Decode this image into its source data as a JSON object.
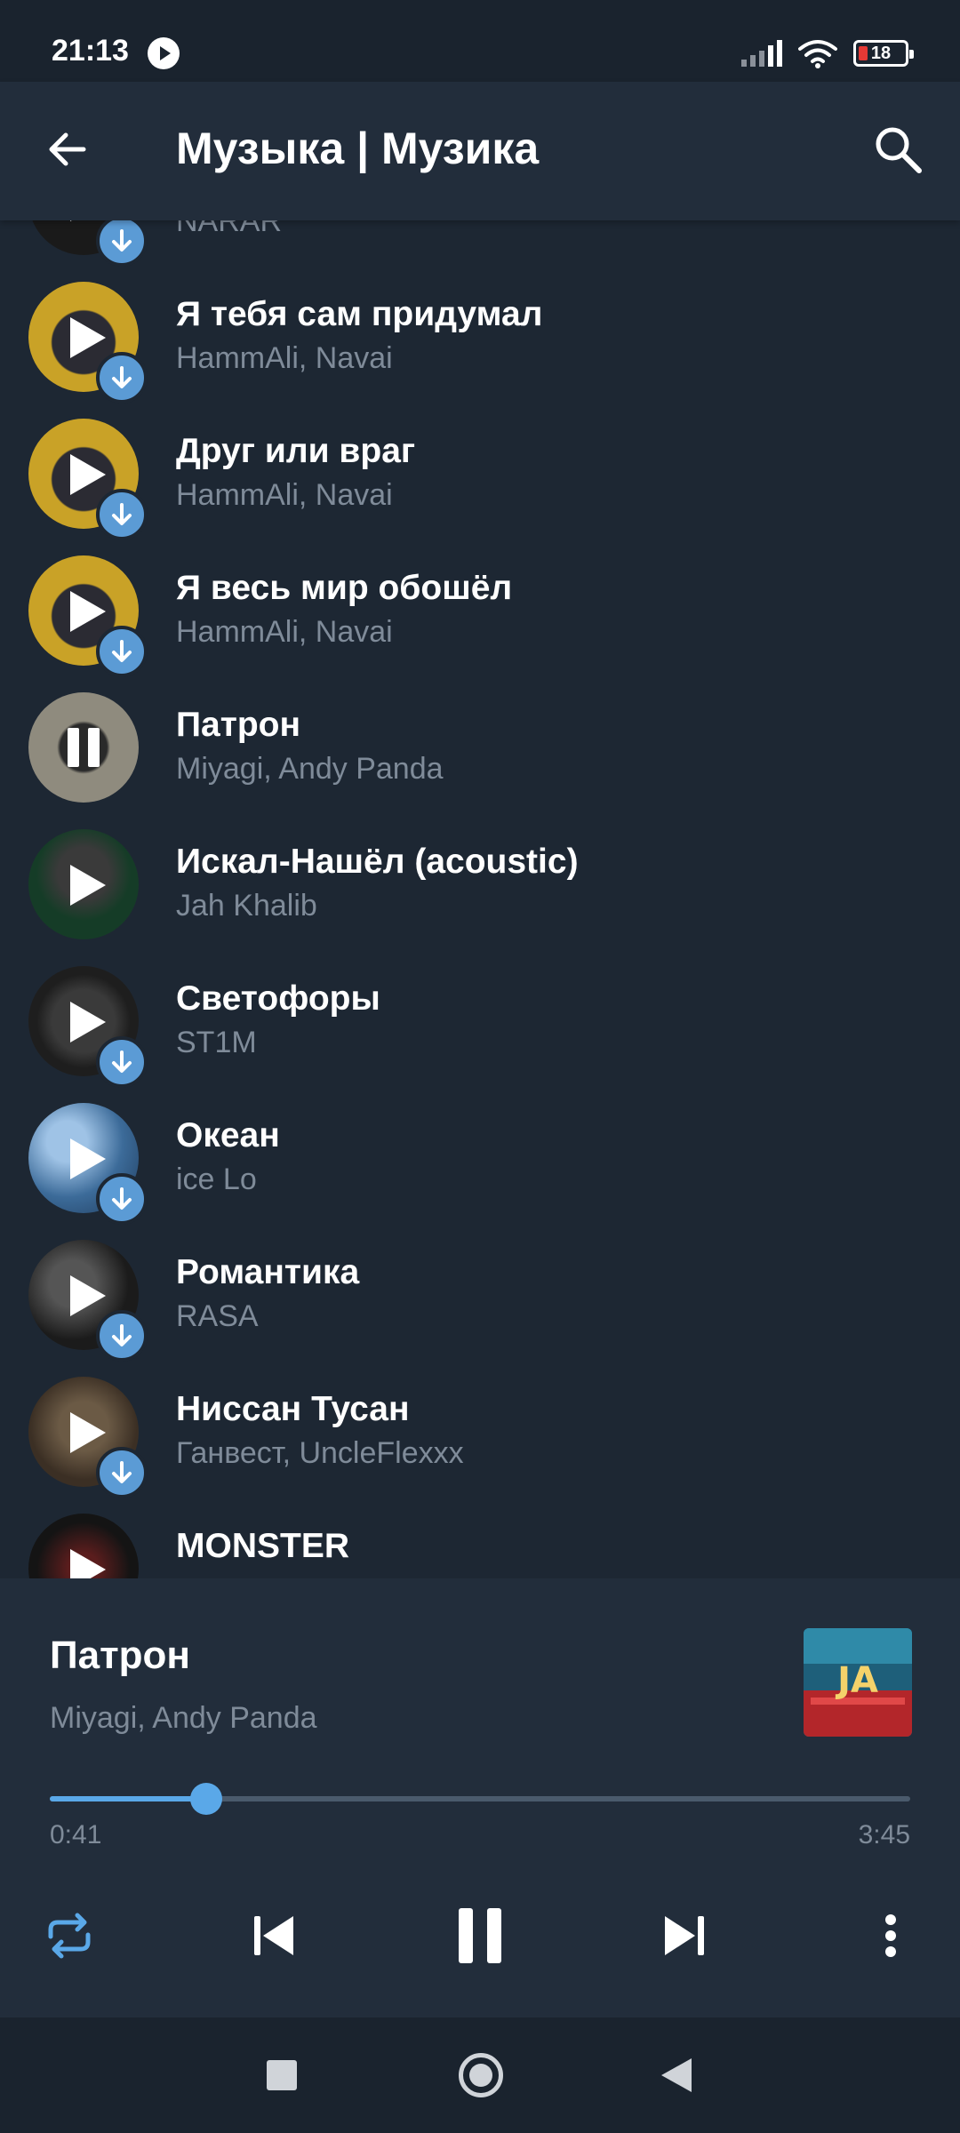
{
  "status": {
    "time": "21:13",
    "battery": "18"
  },
  "header": {
    "title": "Музыка | Музика",
    "back_icon": "arrow-left-icon",
    "search_icon": "search-icon"
  },
  "tracks": [
    {
      "title": "",
      "artist": "NARAR",
      "cover": "dark",
      "downloadable": true,
      "state": "play"
    },
    {
      "title": "Я тебя сам придумал",
      "artist": "HammAli, Navai",
      "cover": "gold",
      "downloadable": true,
      "state": "play"
    },
    {
      "title": "Друг или враг",
      "artist": "HammAli, Navai",
      "cover": "gold",
      "downloadable": true,
      "state": "play"
    },
    {
      "title": "Я весь мир обошёл",
      "artist": "HammAli, Navai",
      "cover": "gold",
      "downloadable": true,
      "state": "play"
    },
    {
      "title": "Патрон",
      "artist": "Miyagi, Andy Panda",
      "cover": "beige",
      "downloadable": false,
      "state": "pause"
    },
    {
      "title": "Искал-Нашёл (acoustic)",
      "artist": "Jah Khalib",
      "cover": "green",
      "downloadable": false,
      "state": "play"
    },
    {
      "title": "Светофоры",
      "artist": "ST1M",
      "cover": "darkgray",
      "downloadable": true,
      "state": "play"
    },
    {
      "title": "Океан",
      "artist": "ice Lo",
      "cover": "blue",
      "downloadable": true,
      "state": "play"
    },
    {
      "title": "Романтика",
      "artist": "RASA",
      "cover": "black",
      "downloadable": true,
      "state": "play"
    },
    {
      "title": "Ниссан Тусан",
      "artist": "Ганвест, UncleFlexxx",
      "cover": "brown",
      "downloadable": true,
      "state": "play"
    },
    {
      "title": "MONSTER",
      "artist": "",
      "cover": "red",
      "downloadable": false,
      "state": "play"
    }
  ],
  "player": {
    "title": "Патрон",
    "artist": "Miyagi, Andy Panda",
    "elapsed": "0:41",
    "duration": "3:45",
    "progress": 0.182,
    "album_art_text": "JA",
    "controls": [
      "repeat-icon",
      "previous-icon",
      "pause-icon",
      "next-icon",
      "more-vertical-icon"
    ]
  },
  "colors": {
    "background": "#1d2733",
    "header": "#222d3b",
    "accent": "#5aa8e8",
    "download_badge": "#5b9bd5",
    "secondary_text": "#7f8b99"
  }
}
